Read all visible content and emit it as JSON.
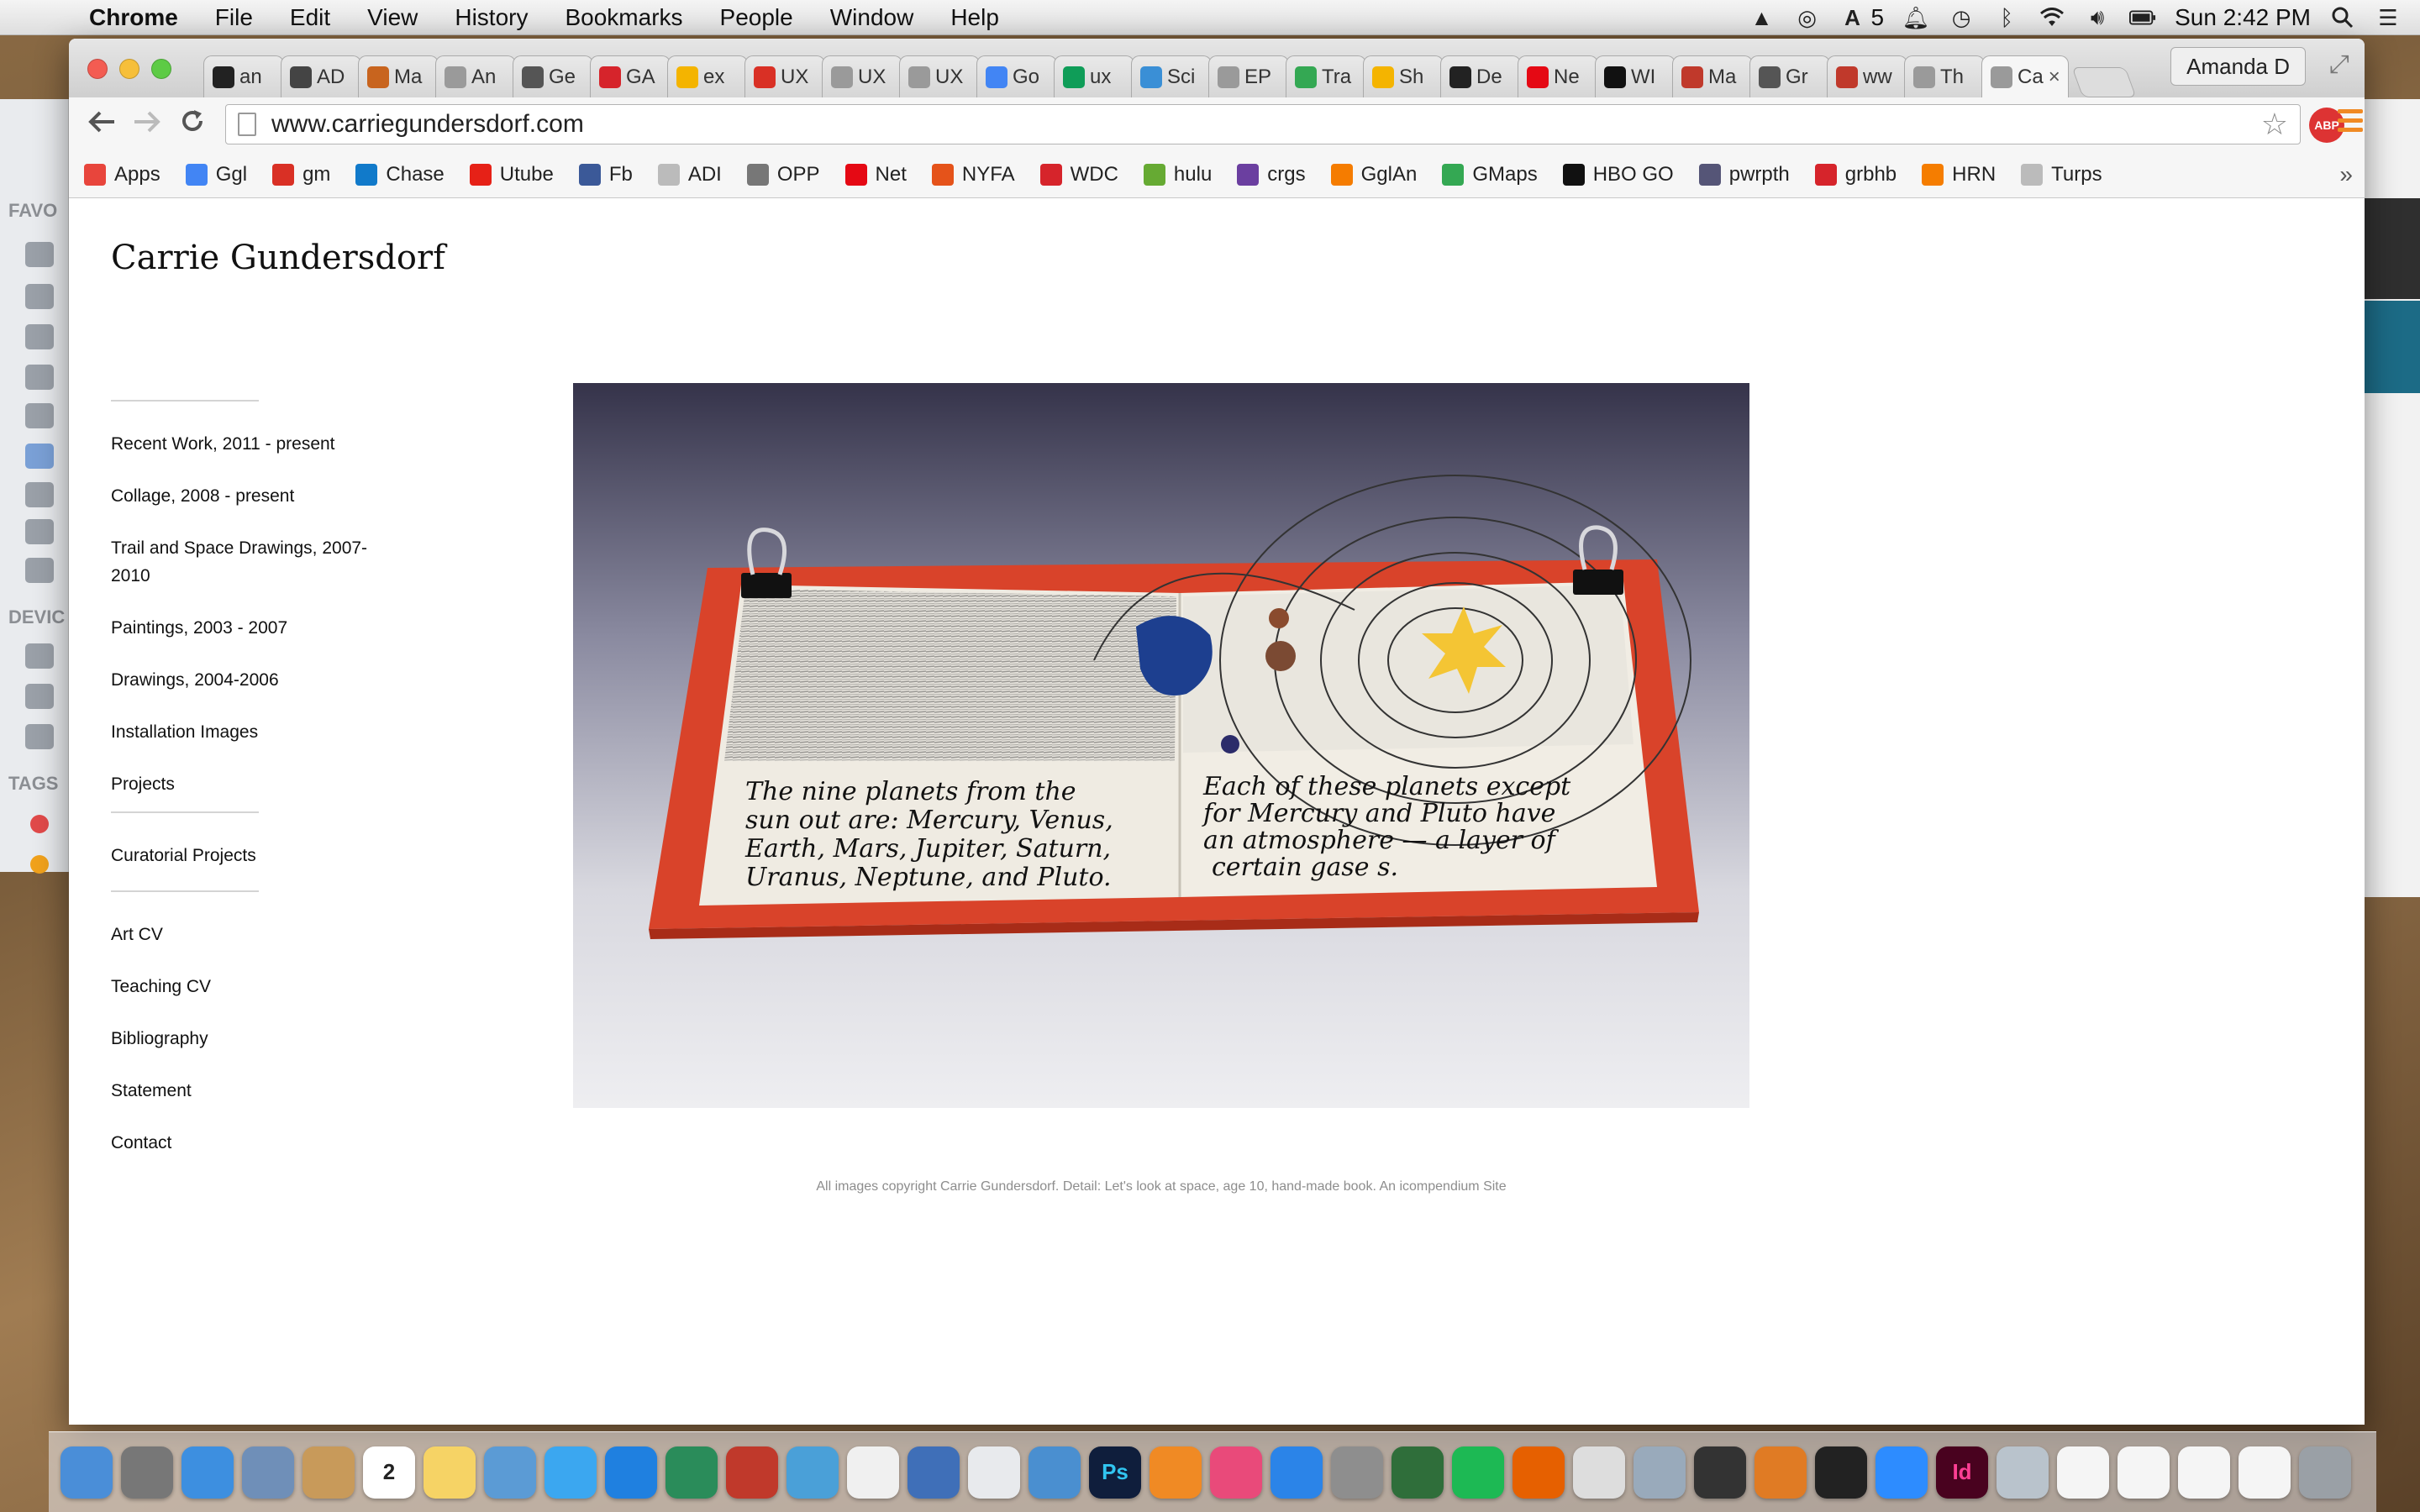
{
  "menubar": {
    "app_name": "Chrome",
    "items": [
      "File",
      "Edit",
      "View",
      "History",
      "Bookmarks",
      "People",
      "Window",
      "Help"
    ],
    "status": {
      "badge_count": "5",
      "clock": "Sun 2:42 PM"
    }
  },
  "finder_sidebar": {
    "favorites_label": "FAVO",
    "devices_label": "DEVIC",
    "tags_label": "TAGS"
  },
  "browser": {
    "tabs": [
      {
        "label": "an",
        "icon": "github-icon",
        "color": "#222222"
      },
      {
        "label": "AD",
        "icon": "codepen-icon",
        "color": "#444444"
      },
      {
        "label": "Ma",
        "icon": "fox-icon",
        "color": "#c8641e"
      },
      {
        "label": "An",
        "icon": "page-icon",
        "color": "#9a9a9a"
      },
      {
        "label": "Ge",
        "icon": "code-icon",
        "color": "#555555"
      },
      {
        "label": "GA",
        "icon": "ga-icon",
        "color": "#d6242b"
      },
      {
        "label": "ex",
        "icon": "slides-icon",
        "color": "#f4b400"
      },
      {
        "label": "UX",
        "icon": "gmail-icon",
        "color": "#d93025"
      },
      {
        "label": "UX",
        "icon": "page-icon",
        "color": "#9a9a9a"
      },
      {
        "label": "UX",
        "icon": "page-icon",
        "color": "#9a9a9a"
      },
      {
        "label": "Go",
        "icon": "google-icon",
        "color": "#4285f4"
      },
      {
        "label": "ux",
        "icon": "drive-icon",
        "color": "#0f9d58"
      },
      {
        "label": "Sci",
        "icon": "gear-icon",
        "color": "#3a8fd6"
      },
      {
        "label": "EP",
        "icon": "page-icon",
        "color": "#9a9a9a"
      },
      {
        "label": "Tra",
        "icon": "maps-icon",
        "color": "#34a853"
      },
      {
        "label": "Sh",
        "icon": "slides-icon",
        "color": "#f4b400"
      },
      {
        "label": "De",
        "icon": "diamond-icon",
        "color": "#222222"
      },
      {
        "label": "Ne",
        "icon": "netflix-icon",
        "color": "#e50914"
      },
      {
        "label": "WI",
        "icon": "circle-b-icon",
        "color": "#111111"
      },
      {
        "label": "Ma",
        "icon": "gw-icon",
        "color": "#c0392b"
      },
      {
        "label": "Gr",
        "icon": "owl-icon",
        "color": "#555555"
      },
      {
        "label": "ww",
        "icon": "gw-icon",
        "color": "#c0392b"
      },
      {
        "label": "Th",
        "icon": "page-icon",
        "color": "#9a9a9a"
      },
      {
        "label": "Ca",
        "icon": "page-icon",
        "color": "#9a9a9a",
        "active": true
      }
    ],
    "profile_name": "Amanda D",
    "url": "www.carriegundersdorf.com",
    "adblock_label": "ABP",
    "bookmarks": [
      {
        "label": "Apps",
        "icon": "apps-grid-icon",
        "color": "#e8453c"
      },
      {
        "label": "Ggl",
        "icon": "google-icon",
        "color": "#4285f4"
      },
      {
        "label": "gm",
        "icon": "gmail-icon",
        "color": "#d93025"
      },
      {
        "label": "Chase",
        "icon": "chase-icon",
        "color": "#117aca"
      },
      {
        "label": "Utube",
        "icon": "youtube-icon",
        "color": "#e62117"
      },
      {
        "label": "Fb",
        "icon": "facebook-icon",
        "color": "#3b5998"
      },
      {
        "label": "ADI",
        "icon": "page-icon",
        "color": "#bbbbbb"
      },
      {
        "label": "OPP",
        "icon": "key-icon",
        "color": "#777777"
      },
      {
        "label": "Net",
        "icon": "netflix-icon",
        "color": "#e50914"
      },
      {
        "label": "NYFA",
        "icon": "nyfa-icon",
        "color": "#e5531a"
      },
      {
        "label": "WDC",
        "icon": "ga-icon",
        "color": "#d6242b"
      },
      {
        "label": "hulu",
        "icon": "hulu-icon",
        "color": "#66aa33"
      },
      {
        "label": "crgs",
        "icon": "peace-icon",
        "color": "#6b3fa0"
      },
      {
        "label": "GglAn",
        "icon": "analytics-icon",
        "color": "#f57c00"
      },
      {
        "label": "GMaps",
        "icon": "maps-icon",
        "color": "#34a853"
      },
      {
        "label": "HBO GO",
        "icon": "hbo-icon",
        "color": "#111111"
      },
      {
        "label": "pwrpth",
        "icon": "pwrpth-icon",
        "color": "#555577"
      },
      {
        "label": "grbhb",
        "icon": "gh-icon",
        "color": "#d6242b"
      },
      {
        "label": "HRN",
        "icon": "blogger-icon",
        "color": "#f57d00"
      },
      {
        "label": "Turps",
        "icon": "page-icon",
        "color": "#bbbbbb"
      }
    ],
    "bookmarks_overflow": "»"
  },
  "site": {
    "title": "Carrie Gundersdorf",
    "nav_groups": [
      [
        "Recent Work, 2011 - present",
        "Collage, 2008 - present",
        "Trail and Space Drawings, 2007-2010",
        "Paintings, 2003 - 2007",
        "Drawings, 2004-2006",
        "Installation Images",
        "Projects"
      ],
      [
        "Curatorial Projects"
      ],
      [
        "Art CV",
        "Teaching CV",
        "Bibliography",
        "Statement",
        "Contact"
      ]
    ],
    "artwork": {
      "left_page_text": [
        "The nine planets from the",
        "sun out are: Mercury, Venus,",
        "Earth, Mars, Jupiter, Saturn,",
        "Uranus, Neptune, and Pluto."
      ],
      "right_page_text": [
        "Each of these planets except",
        "for Mercury and Pluto have",
        "an atmosphere — a layer of",
        "certain gase s."
      ]
    },
    "caption": "All images copyright Carrie Gundersdorf. Detail: Let's look at space, age 10, hand-made book. An icompendium Site"
  },
  "dock": {
    "icons": [
      "finder-icon",
      "launchpad-icon",
      "safari-icon",
      "mail-bird-icon",
      "contacts-icon",
      "calendar-icon",
      "notes-icon",
      "preview-icon",
      "messages-icon",
      "dropbox-icon",
      "facetime-icon",
      "photobooth-icon",
      "iphoto-icon",
      "textedit-icon",
      "keynote-icon",
      "chrome-icon",
      "keynote-podium-icon",
      "photoshop-icon",
      "ibooks-icon",
      "itunes-icon",
      "appstore-icon",
      "system-prefs-icon",
      "world-icon",
      "spotify-icon",
      "firefox-icon",
      "script-icon",
      "preview-photo-icon",
      "x11-icon",
      "sublime-icon",
      "github-icon",
      "zoom-icon",
      "indesign-icon",
      "folder-icon",
      "document-icon",
      "document-icon",
      "document-icon",
      "document-icon",
      "trash-icon"
    ],
    "calendar_day": "2",
    "photoshop_label": "Ps",
    "indesign_label": "Id"
  }
}
